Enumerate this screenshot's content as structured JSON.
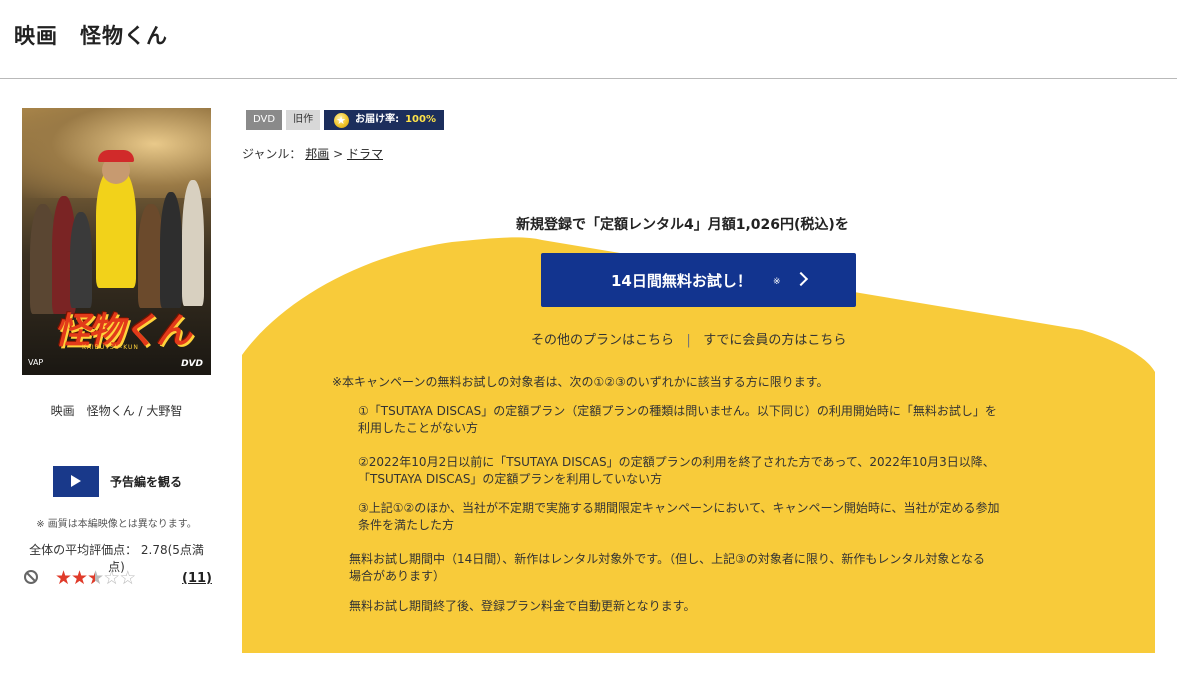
{
  "page": {
    "title": "映画　怪物くん"
  },
  "poster": {
    "logo_text": "怪物くん",
    "logo_small": "映画",
    "logo_sub": "KAIBUTSU-KUN",
    "dvd_mark": "DVD",
    "label_mark": "VAP"
  },
  "item": {
    "caption": "映画　怪物くん / 大野智"
  },
  "trailer": {
    "label": "予告編を観る"
  },
  "notes": {
    "image_quality": "※ 画質は本編映像とは異なります。"
  },
  "rating": {
    "average_text": "全体の平均評価点：  2.78(5点満点)",
    "score": 2.78,
    "max": 5,
    "review_count": "(11)"
  },
  "badges": {
    "format": "DVD",
    "age": "旧作",
    "delivery_label": "お届け率:",
    "delivery_rate": "100%"
  },
  "genre": {
    "label": "ジャンル：",
    "level1": "邦画",
    "separator": ">",
    "level2": "ドラマ"
  },
  "promo": {
    "headline": "新規登録で「定額レンタル4」月額1,026円(税込)を",
    "trial_button": "14日間無料お試し！",
    "trial_mark": "※",
    "other_plans": "その他のプランはこちら",
    "link_separator": "|",
    "members_link": "すでに会員の方はこちら",
    "bg_color": "#f8cb3a",
    "button_color": "#12348f"
  },
  "conditions": {
    "intro": "※本キャンペーンの無料お試しの対象者は、次の①②③のいずれかに該当する方に限ります。",
    "item1_line1": "①「TSUTAYA DISCAS」の定額プラン（定額プランの種類は問いません。以下同じ）の利用開始時に「無料お試し」を",
    "item1_line2": "利用したことがない方",
    "item2_line1": "②2022年10月2日以前に「TSUTAYA DISCAS」の定額プランの利用を終了された方であって、2022年10月3日以降、",
    "item2_line2": "「TSUTAYA DISCAS」の定額プランを利用していない方",
    "item3_line1": "③上記①②のほか、当社が不定期で実施する期間限定キャンペーンにおいて、キャンペーン開始時に、当社が定める参加",
    "item3_line2": "条件を満たした方",
    "note1_line1": "無料お試し期間中（14日間）、新作はレンタル対象外です。（但し、上記③の対象者に限り、新作もレンタル対象となる",
    "note1_line2": "場合があります）",
    "note2": "無料お試し期間終了後、登録プラン料金で自動更新となります。"
  }
}
